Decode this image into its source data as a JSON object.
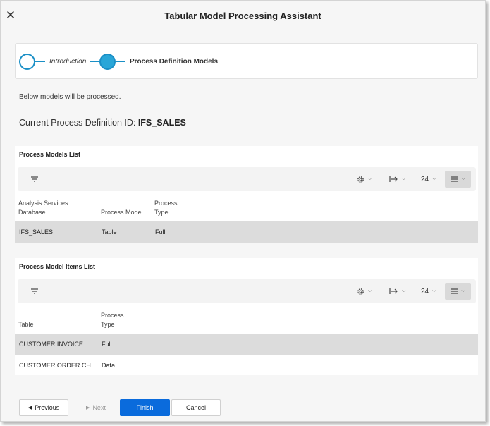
{
  "dialog": {
    "title": "Tabular Model Processing Assistant",
    "close_glyph": "✕"
  },
  "stepper": {
    "steps": [
      {
        "label": "Introduction",
        "state": "completed"
      },
      {
        "label": "Process Definition Models",
        "state": "active"
      }
    ]
  },
  "intro_text": "Below models will be processed.",
  "current_definition": {
    "label": "Current Process Definition ID: ",
    "value": "IFS_SALES"
  },
  "models_panel": {
    "title": "Process Models List",
    "toolbar": {
      "rows_value": "24",
      "settings_icon": "gear-icon",
      "columns_icon": "column-arrow-icon",
      "view_icon": "list-view-icon"
    },
    "columns": [
      "Analysis Services Database",
      "Process Mode",
      "Process Type"
    ],
    "rows": [
      {
        "database": "IFS_SALES",
        "mode": "Table",
        "type": "Full",
        "selected": true
      }
    ]
  },
  "items_panel": {
    "title": "Process Model Items List",
    "toolbar": {
      "rows_value": "24",
      "settings_icon": "gear-icon",
      "columns_icon": "column-arrow-icon",
      "view_icon": "list-view-icon"
    },
    "columns": [
      "Table",
      "Process Type"
    ],
    "rows": [
      {
        "table": "CUSTOMER INVOICE",
        "type": "Full",
        "selected": true
      },
      {
        "table": "CUSTOMER ORDER CH...",
        "type": "Data",
        "selected": false
      }
    ]
  },
  "footer": {
    "previous_label": "Previous",
    "next_label": "Next",
    "finish_label": "Finish",
    "cancel_label": "Cancel"
  },
  "colors": {
    "accent": "#0a6bdc",
    "step": "#29a6d8",
    "selected_row": "#dcdcdc"
  }
}
